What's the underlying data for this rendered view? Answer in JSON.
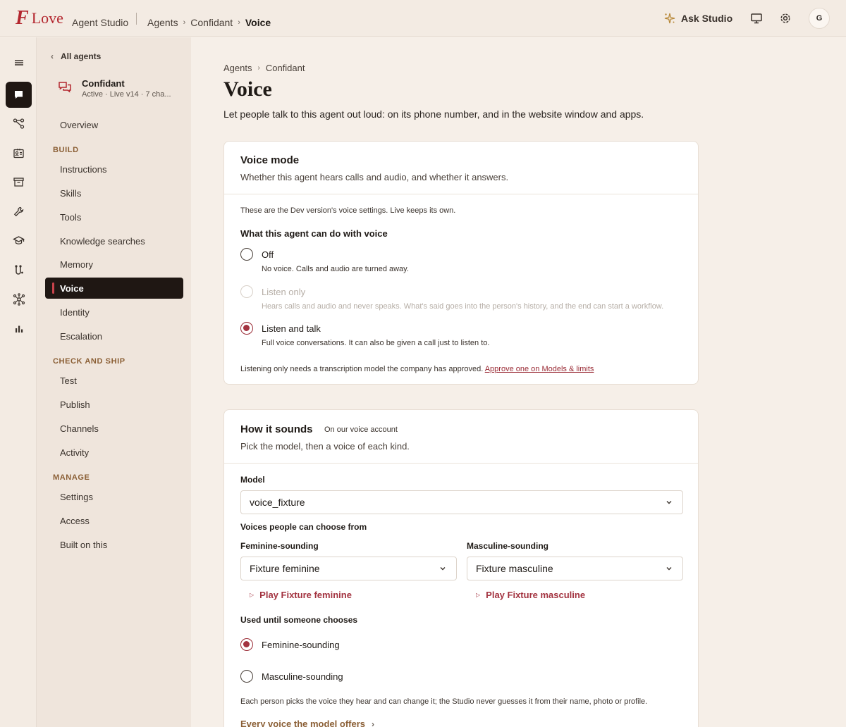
{
  "topbar": {
    "logo_mark": "F",
    "logo_word": "Love",
    "product": "Agent Studio",
    "breadcrumbs": [
      "Agents",
      "Confidant",
      "Voice"
    ],
    "ask_label": "Ask Studio",
    "avatar_initial": "G"
  },
  "sidebar": {
    "back_label": "All agents",
    "agent_name": "Confidant",
    "agent_status": "Active · Live v14 · 7 cha...",
    "overview": "Overview",
    "sections": {
      "build": "BUILD",
      "check": "CHECK AND SHIP",
      "manage": "MANAGE"
    },
    "build_items": [
      "Instructions",
      "Skills",
      "Tools",
      "Knowledge searches",
      "Memory",
      "Voice",
      "Identity",
      "Escalation"
    ],
    "check_items": [
      "Test",
      "Publish",
      "Channels",
      "Activity"
    ],
    "manage_items": [
      "Settings",
      "Access",
      "Built on this"
    ]
  },
  "main": {
    "breadcrumb": [
      "Agents",
      "Confidant"
    ],
    "title": "Voice",
    "description": "Let people talk to this agent out loud: on its phone number, and in the website window and apps."
  },
  "voice_mode": {
    "title": "Voice mode",
    "subtitle": "Whether this agent hears calls and audio, and whether it answers.",
    "note": "These are the Dev version's voice settings. Live keeps its own.",
    "question": "What this agent can do with voice",
    "options": [
      {
        "label": "Off",
        "desc": "No voice. Calls and audio are turned away."
      },
      {
        "label": "Listen only",
        "desc": "Hears calls and audio and never speaks. What's said goes into the person's history, and the end can start a workflow."
      },
      {
        "label": "Listen and talk",
        "desc": "Full voice conversations. It can also be given a call just to listen to."
      }
    ],
    "selected": "Listen and talk",
    "footer_text": "Listening only needs a transcription model the company has approved.",
    "footer_link": "Approve one on Models & limits"
  },
  "how_it_sounds": {
    "title": "How it sounds",
    "tag": "On our voice account",
    "subtitle": "Pick the model, then a voice of each kind.",
    "model_label": "Model",
    "model_value": "voice_fixture",
    "voices_label": "Voices people can choose from",
    "feminine_label": "Feminine-sounding",
    "feminine_value": "Fixture feminine",
    "feminine_play": "Play Fixture feminine",
    "masculine_label": "Masculine-sounding",
    "masculine_value": "Fixture masculine",
    "masculine_play": "Play Fixture masculine",
    "default_label": "Used until someone chooses",
    "default_options": [
      "Feminine-sounding",
      "Masculine-sounding"
    ],
    "default_selected": "Feminine-sounding",
    "note": "Each person picks the voice they hear and can change it; the Studio never guesses it from their name, photo or profile.",
    "more_link": "Every voice the model offers"
  }
}
